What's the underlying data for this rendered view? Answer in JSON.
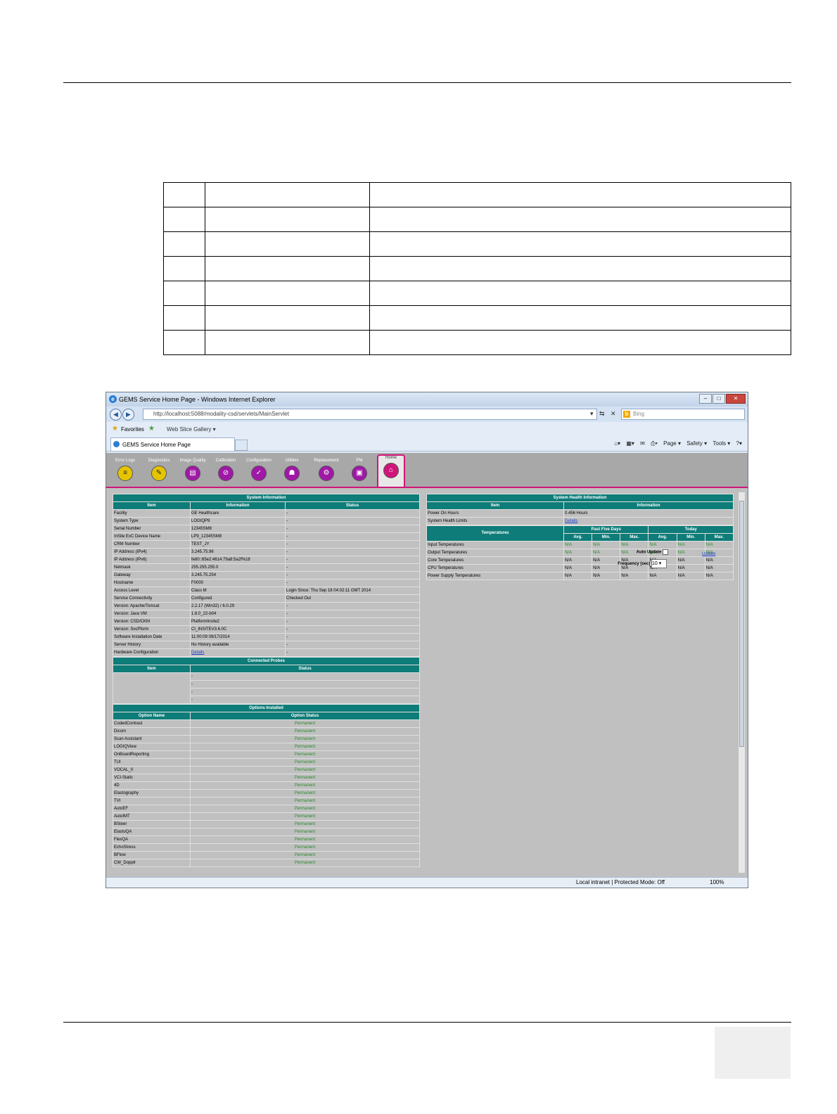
{
  "browser": {
    "title": "GEMS Service Home Page - Windows Internet Explorer",
    "url": "http://localhost:5088/modality-csd/servlets/MainServlet",
    "search_placeholder": "Bing",
    "favorites_label": "Favorites",
    "web_slice_label": "Web Slice Gallery ▾",
    "tab_title": "GEMS Service Home Page",
    "cmd": {
      "page": "Page ▾",
      "safety": "Safety ▾",
      "tools": "Tools ▾"
    },
    "status_zone": "Local intranet | Protected Mode: Off",
    "zoom": "100%"
  },
  "toolbar": [
    {
      "label": "Error Logs",
      "icon": "error-logs-icon",
      "glyph": "≡",
      "color": "y"
    },
    {
      "label": "Diagnostics",
      "icon": "diagnostics-icon",
      "glyph": "✎",
      "color": "y"
    },
    {
      "label": "Image Quality",
      "icon": "image-quality-icon",
      "glyph": "▤",
      "color": "p"
    },
    {
      "label": "Calibration",
      "icon": "calibration-icon",
      "glyph": "⊘",
      "color": "p"
    },
    {
      "label": "Configuration",
      "icon": "configuration-icon",
      "glyph": "✓",
      "color": "p"
    },
    {
      "label": "Utilities",
      "icon": "utilities-icon",
      "glyph": "☗",
      "color": "p"
    },
    {
      "label": "Replacement",
      "icon": "replacement-icon",
      "glyph": "⚙",
      "color": "p"
    },
    {
      "label": "PM",
      "icon": "pm-icon",
      "glyph": "▣",
      "color": "p"
    },
    {
      "label": "Home",
      "icon": "home-icon",
      "glyph": "⌂",
      "color": "p"
    }
  ],
  "system_info": {
    "title": "System Information",
    "headers": [
      "Item",
      "Information",
      "Status"
    ],
    "rows": [
      [
        "Facility",
        "GE Healthcare",
        "-"
      ],
      [
        "System Type",
        "LOGIQP9",
        "-"
      ],
      [
        "Serial Number",
        "12345SM8",
        "-"
      ],
      [
        "InSite ExC Device Name",
        "LP9_12345SM8",
        "-"
      ],
      [
        "CRM Number",
        "TEST_JY",
        "-"
      ],
      [
        "IP Address (IPv4)",
        "3.245.75.96",
        "-"
      ],
      [
        "IP Address (IPv6)",
        "fe80::65e2:4614:79a8:5a2f%18",
        "-"
      ],
      [
        "Netmask",
        "255.255.255.0",
        "-"
      ],
      [
        "Gateway",
        "3.245.75.254",
        "-"
      ],
      [
        "Hostname",
        "F0000",
        "-"
      ],
      [
        "Access Level",
        "Class M",
        "Login Since: Thu Sep 18 04:02:11 GMT 2014"
      ],
      [
        "Service Connectivity",
        "Configured",
        "Checked Out"
      ],
      [
        "Version: Apache/Tomcat",
        "2.2.17 (Win32) / 6.0.29",
        "-"
      ],
      [
        "Version: Java VM",
        "1.6.0_22-b04",
        "-"
      ],
      [
        "Version: CSD/CKM",
        "PlatformInsite2",
        "-"
      ],
      [
        "Version: SvcPform",
        "CI_INSITEV3.6.0C",
        "-"
      ],
      [
        "Software Installation Date",
        "11:00:09 09/17/2014",
        "-"
      ],
      [
        "Server History",
        "No History available",
        "-"
      ],
      [
        "Hardware Configuration",
        "Details",
        "-"
      ]
    ]
  },
  "probes": {
    "title": "Connected Probes",
    "headers": [
      "Item",
      "Status"
    ],
    "rows": [
      "-",
      "-",
      "-",
      "-"
    ]
  },
  "options": {
    "title": "Options Installed",
    "headers": [
      "Option Name",
      "Option Status"
    ],
    "rows": [
      [
        "CodedContrast",
        "Permanent"
      ],
      [
        "Dicom",
        "Permanent"
      ],
      [
        "Scan Assistant",
        "Permanent"
      ],
      [
        "LOGIQView",
        "Permanent"
      ],
      [
        "OnBoardReporting",
        "Permanent"
      ],
      [
        "TUI",
        "Permanent"
      ],
      [
        "VOCAL_II",
        "Permanent"
      ],
      [
        "VCI-Static",
        "Permanent"
      ],
      [
        "4D",
        "Permanent"
      ],
      [
        "Elastography",
        "Permanent"
      ],
      [
        "TVI",
        "Permanent"
      ],
      [
        "AutoEF",
        "Permanent"
      ],
      [
        "AutoIMT",
        "Permanent"
      ],
      [
        "BSteer",
        "Permanent"
      ],
      [
        "ElastoQA",
        "Permanent"
      ],
      [
        "FlexQA",
        "Permanent"
      ],
      [
        "EchoStress",
        "Permanent"
      ],
      [
        "BFlow",
        "Permanent"
      ],
      [
        "CW_Dopplr",
        "Permanent"
      ]
    ]
  },
  "health": {
    "title": "System Health Information",
    "headers": [
      "Item",
      "Information"
    ],
    "rows": [
      [
        "Power On Hours",
        "0.456 Hours"
      ],
      [
        "System Health Limits",
        "Details"
      ]
    ],
    "temps_label": "Temperatures",
    "past_label": "Past Five Days",
    "today_label": "Today",
    "sub": [
      "Avg.",
      "Min.",
      "Max.",
      "Avg.",
      "Min.",
      "Max."
    ],
    "temp_rows": [
      [
        "Input Temperatures",
        "N/A",
        "N/A",
        "N/A",
        "N/A",
        "N/A",
        "N/A"
      ],
      [
        "Output Temperatures",
        "N/A",
        "N/A",
        "N/A",
        "N/A",
        "N/A",
        "N/A"
      ],
      [
        "Core Temperatures",
        "N/A",
        "N/A",
        "N/A",
        "N/A",
        "N/A",
        "N/A"
      ],
      [
        "CPU Temperatures",
        "N/A",
        "N/A",
        "N/A",
        "N/A",
        "N/A",
        "N/A"
      ],
      [
        "Power Supply Temperatures",
        "N/A",
        "N/A",
        "N/A",
        "N/A",
        "N/A",
        "N/A"
      ]
    ],
    "auto_update": "Auto Update",
    "frequency": "Frequency (sec)",
    "frequency_value": "10",
    "update_link": "Update"
  }
}
